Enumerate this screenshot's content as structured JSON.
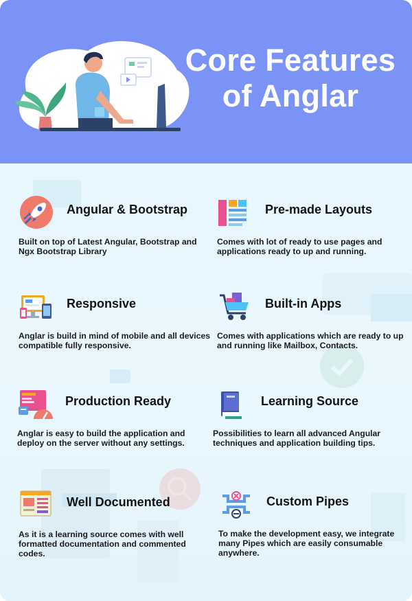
{
  "hero": {
    "title_line1": "Core Features",
    "title_line2": "of Anglar"
  },
  "features": [
    {
      "title": "Angular & Bootstrap",
      "desc": "Built on top of Latest Angular, Bootstrap and Ngx Bootstrap Library",
      "icon": "rocket-icon"
    },
    {
      "title": "Pre-made Layouts",
      "desc": "Comes with lot of ready to use pages and applications ready to up and running.",
      "icon": "layout-icon"
    },
    {
      "title": "Responsive",
      "desc": "Anglar is build in mind of mobile and all devices compatible fully responsive.",
      "icon": "devices-icon"
    },
    {
      "title": "Built-in Apps",
      "desc": "Comes with applications which are ready to up and running like Mailbox, Contacts.",
      "icon": "cart-icon"
    },
    {
      "title": "Production Ready",
      "desc": "Anglar is easy to build the application and deploy on the server without any settings.",
      "icon": "dashboard-icon"
    },
    {
      "title": "Learning Source",
      "desc": "Possibilities to learn all advanced Angular techniques and application building tips.",
      "icon": "book-icon"
    },
    {
      "title": "Well Documented",
      "desc": "As it is a learning source comes with well formatted documentation and commented codes.",
      "icon": "document-icon"
    },
    {
      "title": "Custom Pipes",
      "desc": "To make the development easy, we integrate many Pipes which are easily consumable anywhere.",
      "icon": "pipes-icon"
    }
  ],
  "colors": {
    "hero_bg": "#7b93f7",
    "body_bg": "#e6f6fd",
    "text": "#141414"
  }
}
